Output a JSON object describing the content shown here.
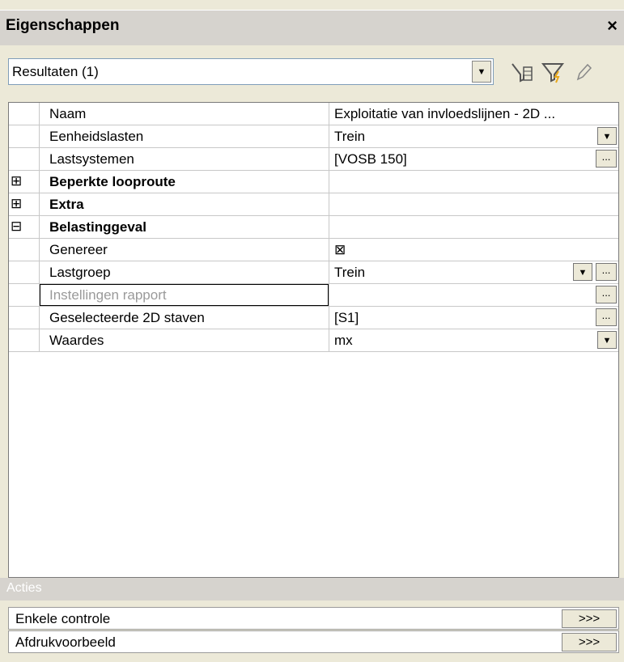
{
  "panel": {
    "title": "Eigenschappen",
    "close_glyph": "×"
  },
  "toolbar": {
    "selection": "Resultaten (1)",
    "icons": [
      "filter-table-icon",
      "filter-lightning-icon",
      "pencil-icon"
    ]
  },
  "properties": {
    "rows": [
      {
        "name": "Naam",
        "value": "Exploitatie van invloedslijnen - 2D ..."
      },
      {
        "name": "Eenheidslasten",
        "value": "Trein"
      },
      {
        "name": "Lastsystemen",
        "value": "[VOSB 150]"
      },
      {
        "name": "Beperkte looproute",
        "expander": "⊞"
      },
      {
        "name": "Extra",
        "expander": "⊞"
      },
      {
        "name": "Belastinggeval",
        "expander": "⊟"
      },
      {
        "name": "Genereer",
        "value": "⊠"
      },
      {
        "name": "Lastgroep",
        "value": "Trein"
      },
      {
        "name": "Instellingen rapport",
        "value": ""
      },
      {
        "name": "Geselecteerde 2D staven",
        "value": "[S1]"
      },
      {
        "name": "Waardes",
        "value": "mx"
      }
    ],
    "ellipsis": "...",
    "dropdown_glyph": "▼"
  },
  "actions": {
    "header": "Acties",
    "items": [
      {
        "label": "Enkele controle",
        "button": ">>>"
      },
      {
        "label": "Afdrukvoorbeeld",
        "button": ">>>"
      }
    ]
  }
}
